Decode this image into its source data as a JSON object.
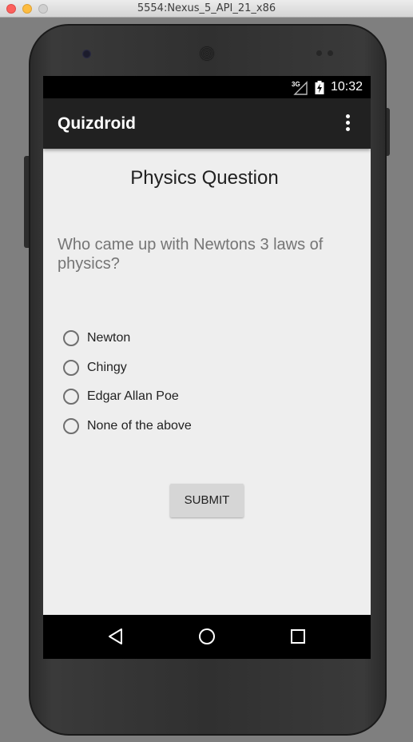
{
  "window": {
    "title": "5554:Nexus_5_API_21_x86"
  },
  "status_bar": {
    "network": "3G",
    "time": "10:32"
  },
  "app_bar": {
    "title": "Quizdroid",
    "menu_icon": "overflow-menu-icon"
  },
  "question": {
    "heading": "Physics Question",
    "text": "Who came up with Newtons 3 laws of physics?",
    "options": [
      {
        "label": "Newton",
        "selected": false
      },
      {
        "label": "Chingy",
        "selected": false
      },
      {
        "label": "Edgar Allan Poe",
        "selected": false
      },
      {
        "label": "None of the above",
        "selected": false
      }
    ]
  },
  "actions": {
    "submit_label": "SUBMIT"
  },
  "nav": {
    "icons": [
      "back-icon",
      "home-icon",
      "recents-icon"
    ]
  },
  "colors": {
    "app_bar": "#212121",
    "screen_background": "#eeeeee",
    "button": "#d6d6d6"
  }
}
